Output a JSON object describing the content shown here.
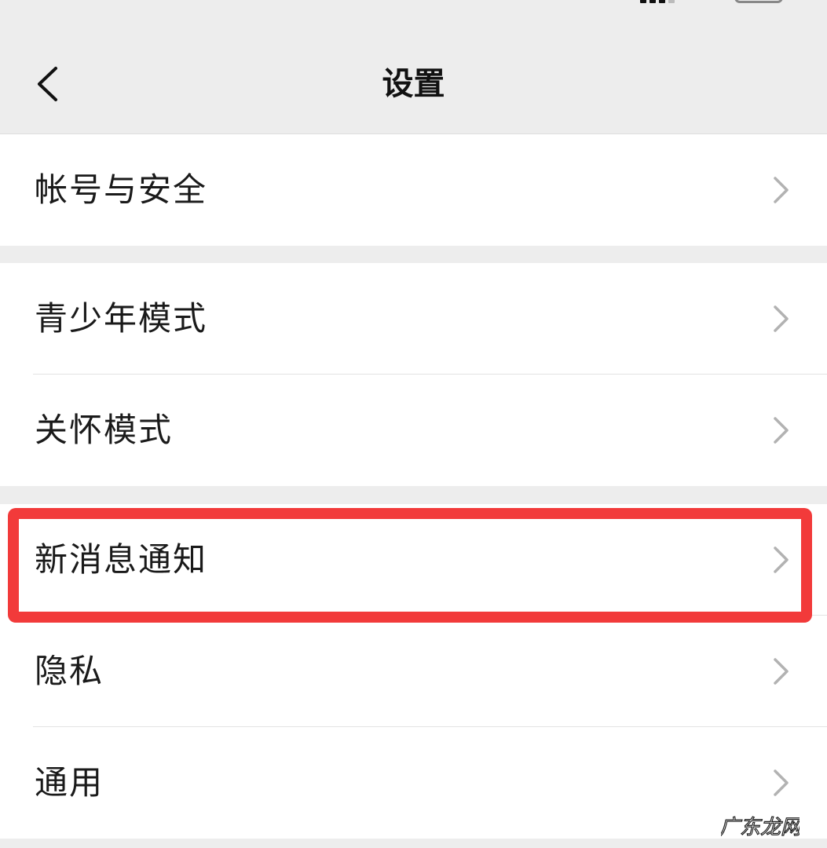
{
  "header": {
    "title": "设置"
  },
  "groups": [
    {
      "items": [
        {
          "label": "帐号与安全"
        }
      ]
    },
    {
      "items": [
        {
          "label": "青少年模式"
        },
        {
          "label": "关怀模式"
        }
      ]
    },
    {
      "items": [
        {
          "label": "新消息通知"
        },
        {
          "label": "隐私"
        },
        {
          "label": "通用"
        }
      ]
    }
  ],
  "annotation": {
    "highlight_color": "#f23a3a"
  },
  "watermark": {
    "text": "广东龙网"
  },
  "colors": {
    "background": "#ededed",
    "row_background": "#ffffff",
    "text": "#1a1a1a",
    "chevron": "#b2b2b2"
  }
}
